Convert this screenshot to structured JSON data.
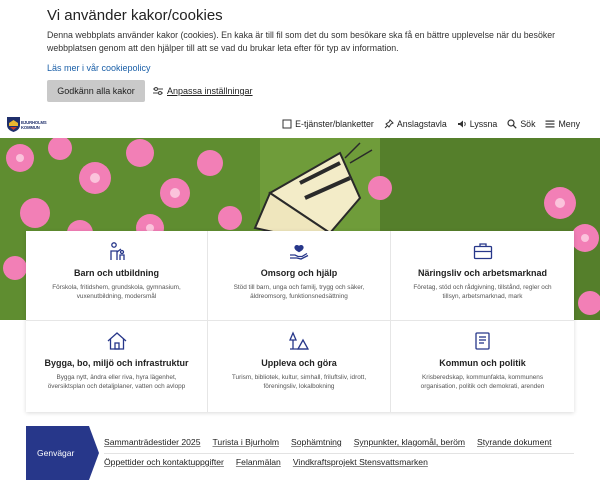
{
  "cookie": {
    "title": "Vi använder kakor/cookies",
    "text": "Denna webbplats använder kakor (cookies). En kaka är till fil som det du som besökare ska få en bättre upplevelse när du besöker webbplatsen genom att den hjälper till att se vad du brukar leta efter för typ av information.",
    "policy_link": "Läs mer i vår cookiepolicy",
    "accept_label": "Godkänn alla kakor",
    "customize_label": "Anpassa inställningar"
  },
  "header": {
    "logo_text_line1": "BJURHOLMS",
    "logo_text_line2": "KOMMUN",
    "nav": [
      {
        "label": "E-tjänster/blanketter",
        "icon": "form-icon"
      },
      {
        "label": "Anslagstavla",
        "icon": "pin-icon"
      },
      {
        "label": "Lyssna",
        "icon": "speaker-icon"
      },
      {
        "label": "Sök",
        "icon": "search-icon"
      },
      {
        "label": "Meny",
        "icon": "menu-icon"
      }
    ]
  },
  "categories": [
    {
      "title": "Barn och utbildning",
      "text": "Förskola, fritidshem, grundskola, gymnasium, vuxenutbildning, modersmål",
      "icon": "child-icon"
    },
    {
      "title": "Omsorg och hjälp",
      "text": "Stöd till barn, unga och familj, trygg och säker, äldreomsorg, funktionsnedsättning",
      "icon": "hand-heart-icon"
    },
    {
      "title": "Näringsliv och arbetsmarknad",
      "text": "Företag, stöd och rådgivning, tillstånd, regler och tillsyn, arbetsmarknad, mark",
      "icon": "briefcase-icon"
    },
    {
      "title": "Bygga, bo, miljö och infrastruktur",
      "text": "Bygga nytt, ändra eller riva, hyra lägenhet, översiktsplan och detaljplaner, vatten och avlopp",
      "icon": "house-icon"
    },
    {
      "title": "Uppleva och göra",
      "text": "Turism, bibliotek, kultur, simhall, friluftsliv, idrott, föreningsliv, lokalbokning",
      "icon": "tent-tree-icon"
    },
    {
      "title": "Kommun och politik",
      "text": "Krisberedskap, kommunfakta, kommunens organisation, politik och demokrati, arenden",
      "icon": "document-icon"
    }
  ],
  "shortcuts": {
    "tab_label": "Genvägar",
    "links": [
      "Sammanträdestider 2025",
      "Turista i Bjurholm",
      "Sophämtning",
      "Synpunkter, klagomål, beröm",
      "Styrande dokument",
      "Öppettider och kontaktuppgifter",
      "Felanmälan",
      "Vindkraftsprojekt Stensvattsmarken"
    ]
  },
  "colors": {
    "brand": "#27378a",
    "link": "#1a5fa8",
    "accept_button": "#c9c9c9"
  }
}
